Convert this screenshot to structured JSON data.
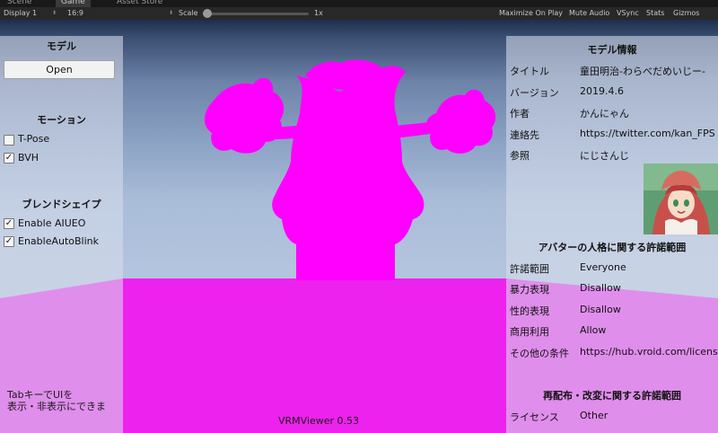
{
  "editor": {
    "tabs": [
      "Scene",
      "Game",
      "Asset Store"
    ],
    "display": "Display 1",
    "aspect": "16:9",
    "scale_label": "Scale",
    "scale_value": "1x",
    "toolbar_buttons": [
      "Maximize On Play",
      "Mute Audio",
      "VSync",
      "Stats",
      "Gizmos"
    ]
  },
  "left_panel": {
    "model_heading": "モデル",
    "open_button": "Open",
    "motion_heading": "モーション",
    "tpose_label": "T-Pose",
    "tpose_checked": false,
    "bvh_label": "BVH",
    "bvh_checked": true,
    "blend_heading": "ブレンドシェイプ",
    "aiueo_label": "Enable AIUEO",
    "aiueo_checked": true,
    "autoblink_label": "EnableAutoBlink",
    "autoblink_checked": true,
    "hint_line1": "TabキーでUIを",
    "hint_line2": "表示・非表示にできま"
  },
  "model_info": {
    "heading": "モデル情報",
    "rows": [
      {
        "key": "タイトル",
        "value": "童田明治-わらべだめいじー-"
      },
      {
        "key": "バージョン",
        "value": "2019.4.6"
      },
      {
        "key": "作者",
        "value": "かんにゃん"
      },
      {
        "key": "連絡先",
        "value": "https://twitter.com/kan_FPS"
      },
      {
        "key": "参照",
        "value": "にじさんじ"
      }
    ]
  },
  "permissions": {
    "heading": "アバターの人格に関する許諾範囲",
    "rows": [
      {
        "key": "許諾範囲",
        "value": "Everyone"
      },
      {
        "key": "暴力表現",
        "value": "Disallow"
      },
      {
        "key": "性的表現",
        "value": "Disallow"
      },
      {
        "key": "商用利用",
        "value": "Allow"
      },
      {
        "key": "その他の条件",
        "value": "https://hub.vroid.com/license?a"
      }
    ]
  },
  "redistribution": {
    "heading": "再配布・改変に関する許諾範囲",
    "rows": [
      {
        "key": "ライセンス",
        "value": "Other"
      }
    ]
  },
  "footer": {
    "version": "VRMViewer 0.53"
  },
  "colors": {
    "silhouette": "#ff00ff",
    "ground": "#ee22ee"
  }
}
